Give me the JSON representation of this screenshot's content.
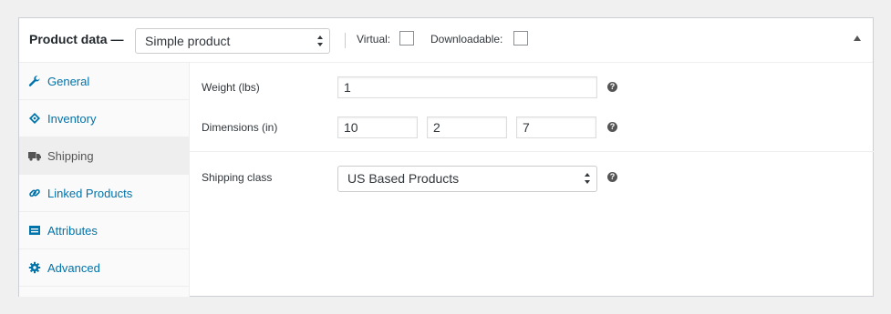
{
  "header": {
    "title": "Product data —",
    "product_type": "Simple product",
    "virtual_label": "Virtual:",
    "virtual_checked": false,
    "downloadable_label": "Downloadable:",
    "downloadable_checked": false
  },
  "tabs": [
    {
      "label": "General",
      "icon": "wrench-icon",
      "active": false
    },
    {
      "label": "Inventory",
      "icon": "tag-icon",
      "active": false
    },
    {
      "label": "Shipping",
      "icon": "truck-icon",
      "active": true
    },
    {
      "label": "Linked Products",
      "icon": "link-icon",
      "active": false
    },
    {
      "label": "Attributes",
      "icon": "list-icon",
      "active": false
    },
    {
      "label": "Advanced",
      "icon": "gear-icon",
      "active": false
    }
  ],
  "shipping": {
    "weight_label": "Weight (lbs)",
    "weight_value": "1",
    "dimensions_label": "Dimensions (in)",
    "length_value": "10",
    "width_value": "2",
    "height_value": "7",
    "class_label": "Shipping class",
    "class_value": "US Based Products",
    "help_glyph": "?"
  },
  "colors": {
    "link": "#0073aa",
    "active_tab_bg": "#eeeeee",
    "background": "#f0f0f1"
  }
}
